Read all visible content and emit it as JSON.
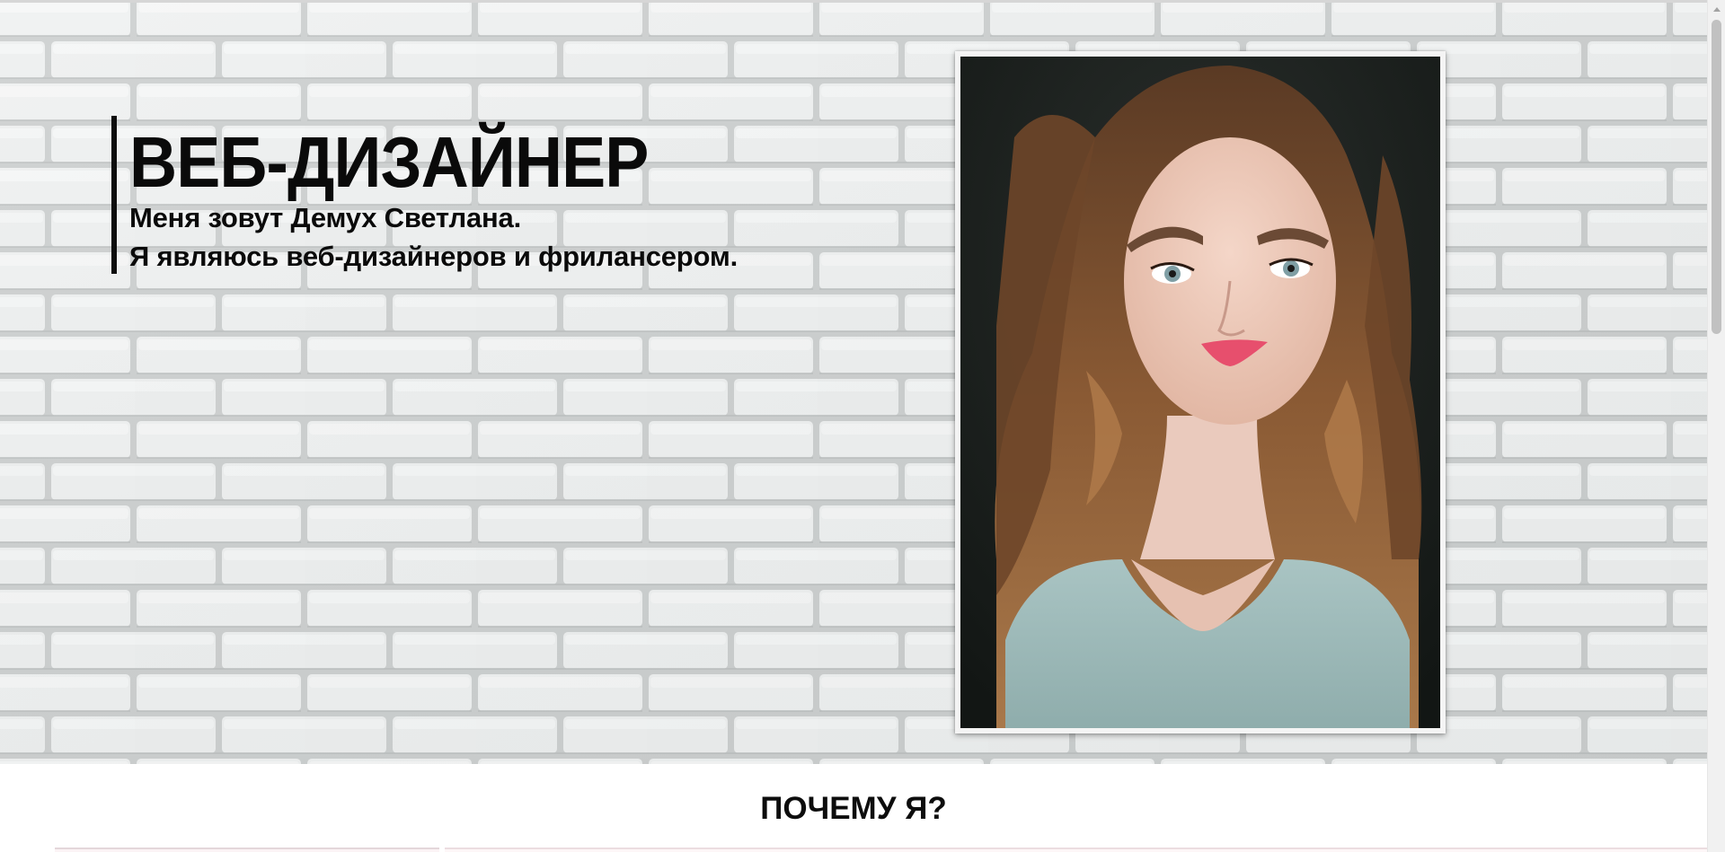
{
  "hero": {
    "title": "ВЕБ-ДИЗАЙНЕР",
    "line1": "Меня зовут Демух Светлана.",
    "line2": "Я являюсь веб-дизайнеров и фрилансером.",
    "background": "white-brick-wall",
    "photo": "portrait-photo"
  },
  "why": {
    "heading": "ПОЧЕМУ Я?"
  },
  "colors": {
    "text": "#0a0a0a",
    "brick": "#e9ebeb",
    "accent_bar": "#0d0d0d"
  }
}
